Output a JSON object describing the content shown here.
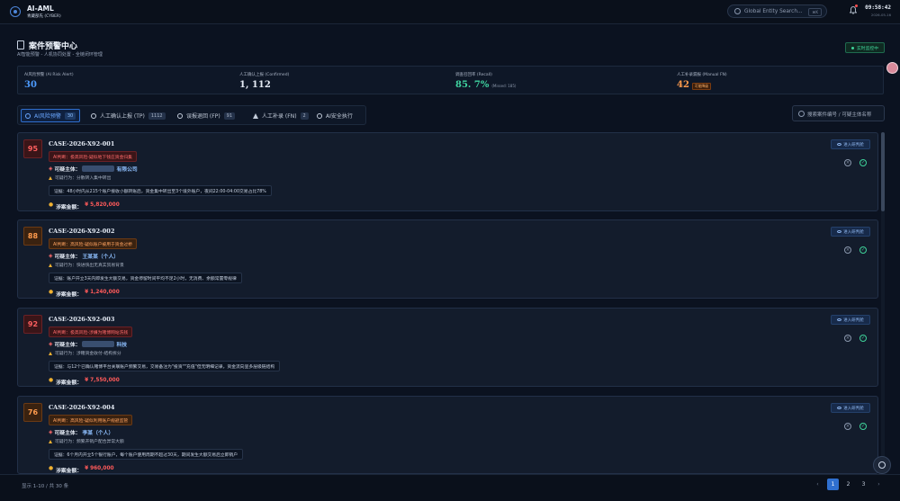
{
  "app": {
    "title": "AI-AML",
    "subtitle": "青藏部先 (CYBER)",
    "search_placeholder": "Global Entity Search...",
    "search_kbd": "⌘K",
    "time": "09:58:42",
    "date": "2026-05-16"
  },
  "header": {
    "title": "案件预警中心",
    "subtitle": "AI智能预警 - 人机协同处置 - 全链闭环管理",
    "live_label": "实时监控中"
  },
  "stats": [
    {
      "label": "AI风险预警 (AI Risk Alert)",
      "value": "30",
      "note": "",
      "tag": "",
      "color": "#4d9bff"
    },
    {
      "label": "人工确认上报 (Confirmed)",
      "value": "1, 112",
      "note": "",
      "tag": "",
      "color": "#e6ecf6"
    },
    {
      "label": "调查召回率 (Recall)",
      "value": "85. 7%",
      "note": "(Missed: 185)",
      "tag": "",
      "color": "#3fd3a0"
    },
    {
      "label": "人工补录漏报 (Manual FN)",
      "value": "42",
      "note": "",
      "tag": "可能降级",
      "color": "#ff9b4d"
    }
  ],
  "tabs": [
    {
      "label": "AI风险预警",
      "count": "30"
    },
    {
      "label": "人工确认上报 (TP)",
      "count": "1112"
    },
    {
      "label": "误报退回 (FP)",
      "count": "91"
    },
    {
      "label": "人工补录 (FN)",
      "count": "2"
    },
    {
      "label": "AI安全执行",
      "count": ""
    }
  ],
  "case_search_placeholder": "搜索案件编号 / 可疑主体名称",
  "cases": [
    {
      "score": "95",
      "score_color": "#ff5f5f",
      "score_bg": "#3a1518",
      "id": "CASE-2026-X92-001",
      "verdict": "AI判断：极高风险-疑似地下钱庄资金归集",
      "verdict_color": "#ff6b6b",
      "verdict_bg": "#3a1518",
      "verdict_border": "#6a2126",
      "subject_label": "可疑主体：",
      "subject": "有限公司",
      "behavior": "可疑行为：分散转入集中转出",
      "evidence": "证据：48小时内从215个账户接收小额转账后，资金集中转出至3个境外账户，夜间22:00-04:00交易占比78%",
      "amount_label": "涉案金额：",
      "amount": "¥ 5,820,000",
      "enter": "进入研判舱"
    },
    {
      "score": "88",
      "score_color": "#ff9b4d",
      "score_bg": "#3a2210",
      "id": "CASE-2026-X92-002",
      "verdict": "AI判断：高风险-疑似账户被用于资金过桥",
      "verdict_color": "#ffa361",
      "verdict_bg": "#3a2210",
      "verdict_border": "#6b3a14",
      "subject_label": "可疑主体：",
      "subject": "王某某（个人）",
      "behavior": "可疑行为：快进快出无真实贸易背景",
      "evidence": "证据：账户开立3天内即发生大额交易，资金停留时间平均不足2小时，无消费、余额常置零规律",
      "amount_label": "涉案金额：",
      "amount": "¥ 1,240,000",
      "enter": "进入研判舱"
    },
    {
      "score": "92",
      "score_color": "#ff5f5f",
      "score_bg": "#3a1518",
      "id": "CASE-2026-X92-003",
      "verdict": "AI判断：极高风险-涉嫌为赌博网站洗钱",
      "verdict_color": "#ff6b6b",
      "verdict_bg": "#3a1518",
      "verdict_border": "#6a2126",
      "subject_label": "可疑主体：",
      "subject": "科技",
      "behavior": "可疑行为：涉赌资金收付-结构拆分",
      "evidence": "证据：与12个已确认赌博平台关联账户频繁交易，交易备注为\"投资\"\"充值\"但无明细记录，资金流向呈多层级链结构",
      "amount_label": "涉案金额：",
      "amount": "¥ 7,550,000",
      "enter": "进入研判舱"
    },
    {
      "score": "76",
      "score_color": "#ff9b4d",
      "score_bg": "#3a2210",
      "id": "CASE-2026-X92-004",
      "verdict": "AI判断：高风险-疑似利用账户规避监管",
      "verdict_color": "#ffa361",
      "verdict_bg": "#3a2210",
      "verdict_border": "#6b3a14",
      "subject_label": "可疑主体：",
      "subject": "李某（个人）",
      "behavior": "可疑行为：频繁开销户配合异常大额",
      "evidence": "证据：6个月内开立5个银行账户，每个账户使用周期不超过30天，期间发生大额交易后立即销户",
      "amount_label": "涉案金额：",
      "amount": "¥ 960,000",
      "enter": "进入研判舱"
    }
  ],
  "footer": {
    "page_info": "显示 1-10 / 共 30 条",
    "pages": [
      "1",
      "2",
      "3"
    ],
    "prev": "‹",
    "next": "›"
  }
}
